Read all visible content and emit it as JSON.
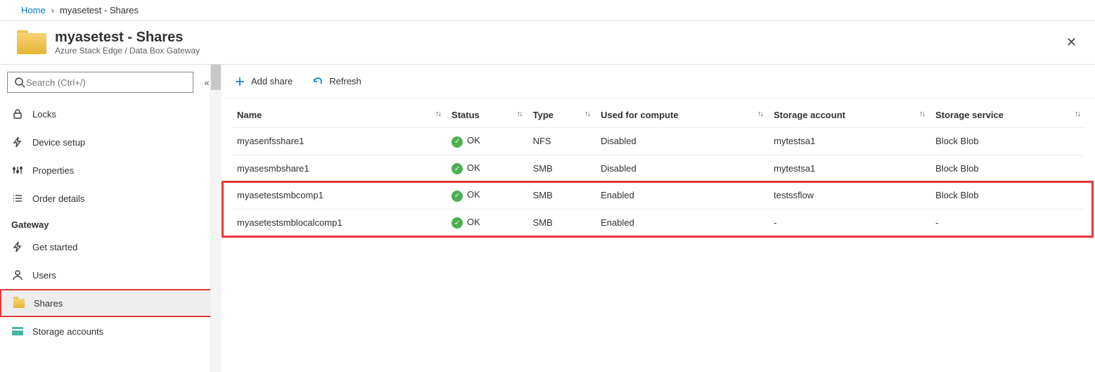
{
  "breadcrumb": {
    "home": "Home",
    "current": "myasetest - Shares"
  },
  "header": {
    "title": "myasetest - Shares",
    "subtitle": "Azure Stack Edge / Data Box Gateway"
  },
  "search": {
    "placeholder": "Search (Ctrl+/)"
  },
  "sidebar": {
    "items": [
      {
        "label": "Locks"
      },
      {
        "label": "Device setup"
      },
      {
        "label": "Properties"
      },
      {
        "label": "Order details"
      }
    ],
    "section": "Gateway",
    "gateway": [
      {
        "label": "Get started"
      },
      {
        "label": "Users"
      },
      {
        "label": "Shares"
      },
      {
        "label": "Storage accounts"
      }
    ]
  },
  "toolbar": {
    "add": "Add share",
    "refresh": "Refresh"
  },
  "table": {
    "headers": {
      "name": "Name",
      "status": "Status",
      "type": "Type",
      "used": "Used for compute",
      "storage": "Storage account",
      "service": "Storage service"
    },
    "rows": [
      {
        "name": "myasenfsshare1",
        "status": "OK",
        "type": "NFS",
        "used": "Disabled",
        "storage": "mytestsa1",
        "service": "Block Blob"
      },
      {
        "name": "myasesmbshare1",
        "status": "OK",
        "type": "SMB",
        "used": "Disabled",
        "storage": "mytestsa1",
        "service": "Block Blob"
      },
      {
        "name": "myasetestsmbcomp1",
        "status": "OK",
        "type": "SMB",
        "used": "Enabled",
        "storage": "testssflow",
        "service": "Block Blob"
      },
      {
        "name": "myasetestsmblocalcomp1",
        "status": "OK",
        "type": "SMB",
        "used": "Enabled",
        "storage": "-",
        "service": "-"
      }
    ]
  }
}
